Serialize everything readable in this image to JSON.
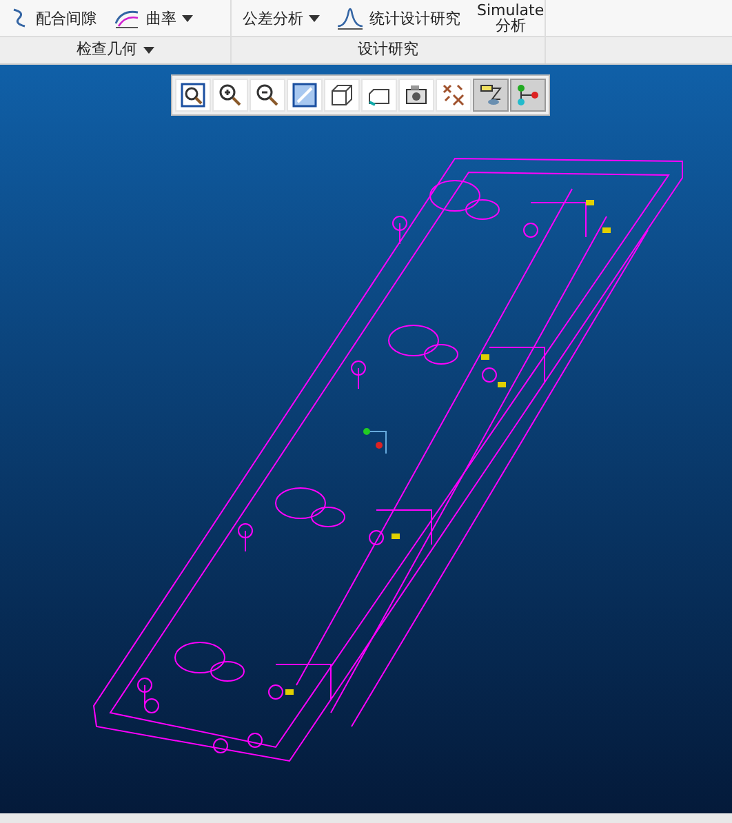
{
  "ribbon": {
    "groups": [
      {
        "label": "检查几何",
        "has_menu": true,
        "commands": [
          {
            "label": "配合间隙",
            "kind": "clearance",
            "has_menu": false
          },
          {
            "label": "曲率",
            "kind": "curvature",
            "has_menu": true
          }
        ]
      },
      {
        "label": "设计研究",
        "has_menu": false,
        "commands": [
          {
            "label": "公差分析",
            "kind": "tolerance",
            "has_menu": true
          },
          {
            "label": "统计设计研究",
            "kind": "statistics",
            "has_menu": false
          },
          {
            "label": "Simulate\n分析",
            "kind": "simulate",
            "has_menu": false
          }
        ]
      }
    ]
  },
  "view_toolbar": [
    {
      "kind": "refit",
      "selected": false
    },
    {
      "kind": "zoom-in",
      "selected": false
    },
    {
      "kind": "zoom-out",
      "selected": false
    },
    {
      "kind": "repaint",
      "selected": false
    },
    {
      "kind": "display-style",
      "selected": false
    },
    {
      "kind": "saved-views",
      "selected": false
    },
    {
      "kind": "view-manager",
      "selected": false
    },
    {
      "kind": "datum-display",
      "selected": false
    },
    {
      "kind": "annotations",
      "selected": true
    },
    {
      "kind": "spin-center",
      "selected": true
    }
  ]
}
